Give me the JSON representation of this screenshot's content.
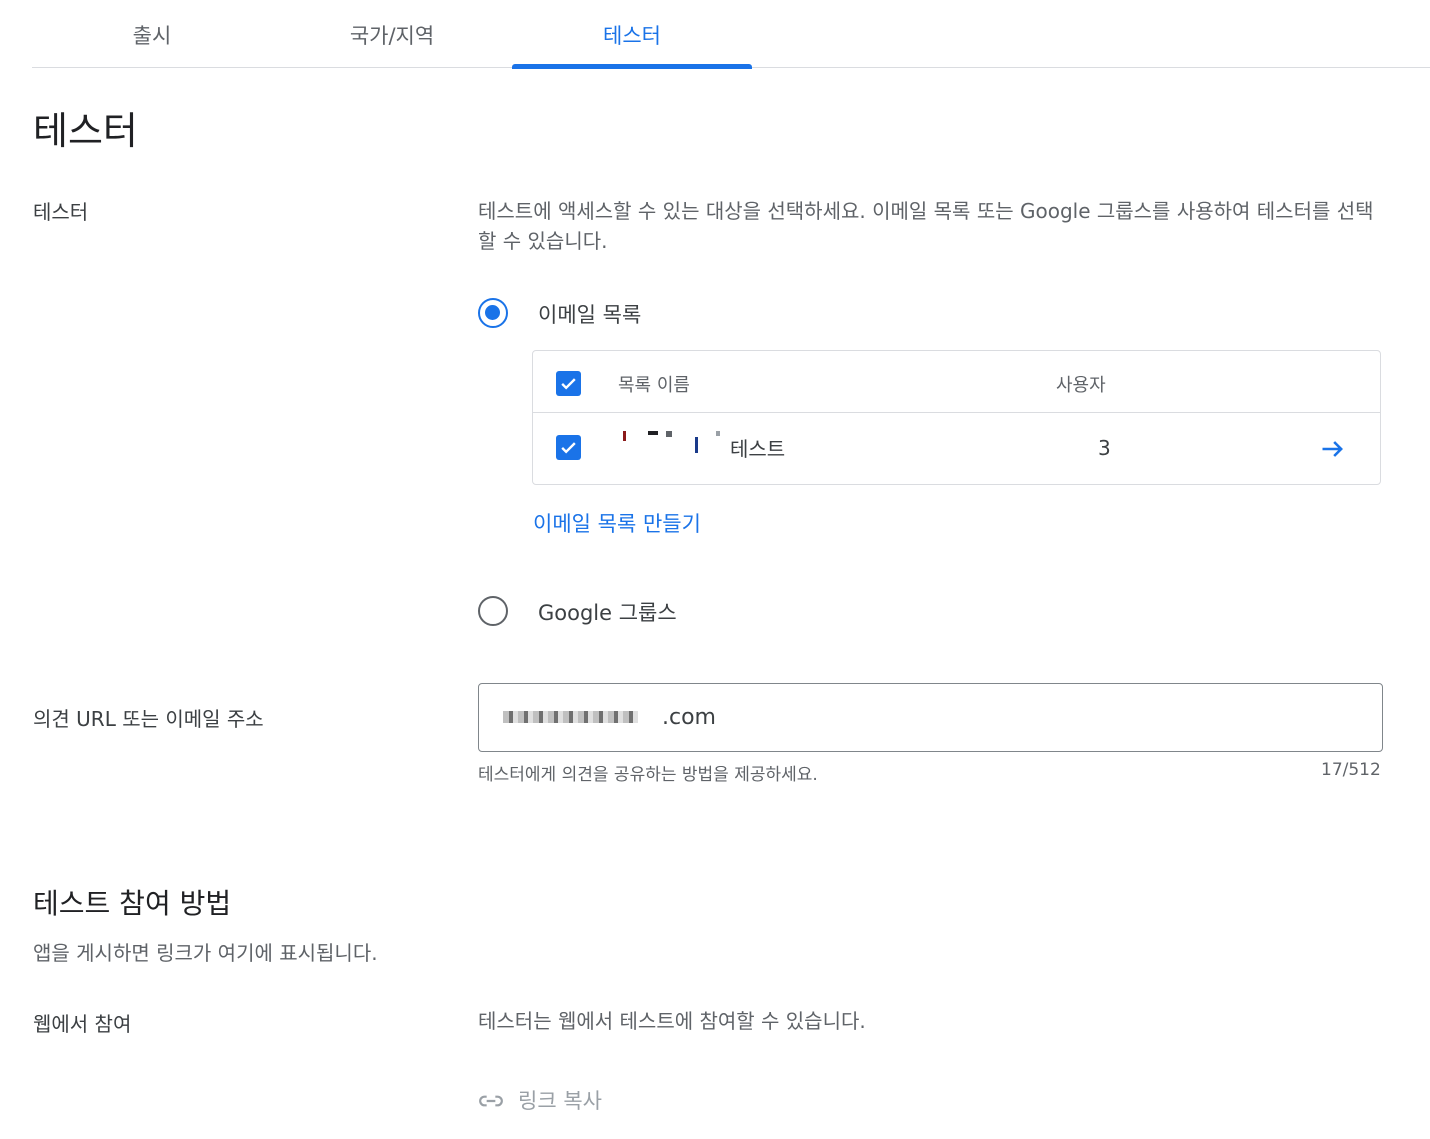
{
  "tabs": [
    {
      "label": "출시"
    },
    {
      "label": "국가/지역"
    },
    {
      "label": "테스터"
    }
  ],
  "page_title": "테스터",
  "testers_section": {
    "label": "테스터",
    "description": "테스트에 액세스할 수 있는 대상을 선택하세요. 이메일 목록 또는 Google 그룹스를 사용하여 테스터를 선택할 수 있습니다.",
    "option_email_list": "이메일 목록",
    "option_google_groups": "Google 그룹스",
    "selected_option": "이메일 목록",
    "table": {
      "col_list_name": "목록 이름",
      "col_users": "사용자",
      "rows": [
        {
          "name": "테스트",
          "users": "3",
          "checked": true
        }
      ]
    },
    "create_list_link": "이메일 목록 만들기"
  },
  "feedback": {
    "label": "의견 URL 또는 이메일 주소",
    "value": ".com",
    "helper": "테스터에게 의견을 공유하는 방법을 제공하세요.",
    "counter": "17/512"
  },
  "join_section": {
    "title": "테스트 참여 방법",
    "subtitle": "앱을 게시하면 링크가 여기에 표시됩니다.",
    "web_label": "웹에서 참여",
    "web_desc": "테스터는 웹에서 테스트에 참여할 수 있습니다.",
    "copy_link": "링크 복사"
  },
  "colors": {
    "accent": "#1a73e8",
    "text": "#3c4043",
    "muted": "#5f6368",
    "disabled": "#9aa0a6"
  }
}
